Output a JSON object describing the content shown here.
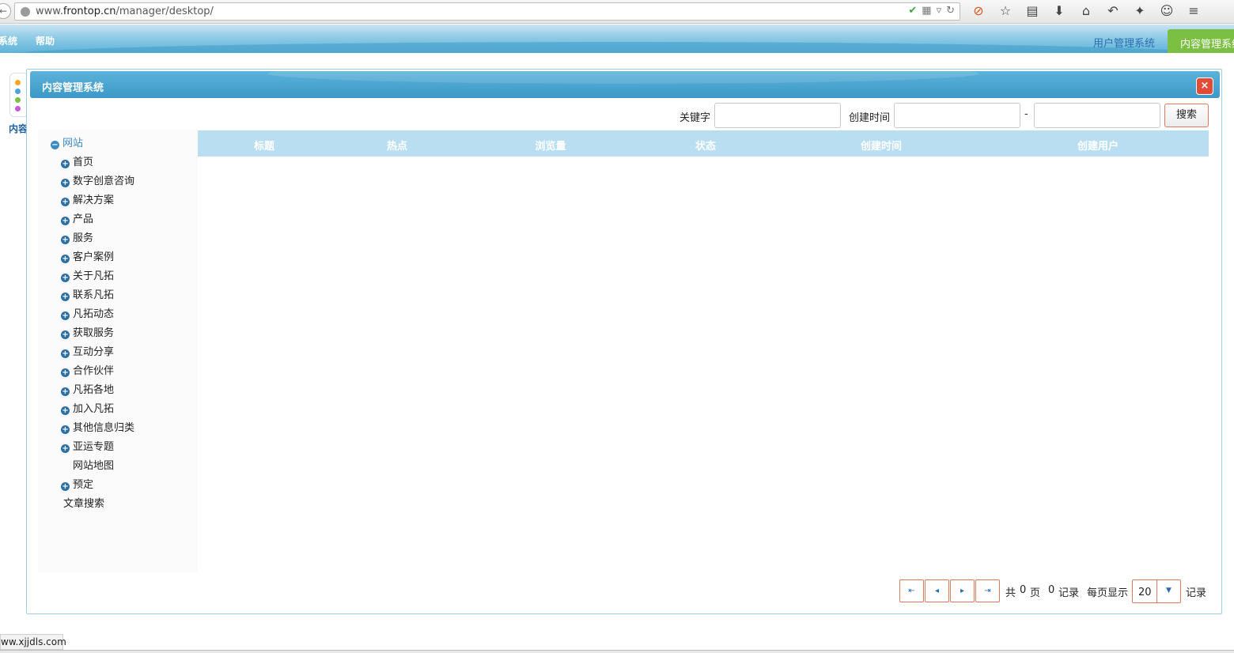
{
  "browser": {
    "url_prefix": "www.",
    "url_domain": "frontop.cn",
    "url_path": "/manager/desktop/"
  },
  "header": {
    "menu": [
      "系统",
      "帮助"
    ],
    "sys_link": "用户管理系统",
    "sys_tab_active": "内容管理系统"
  },
  "desktop": {
    "dock_label": "内容"
  },
  "modal": {
    "title": "内容管理系统"
  },
  "search": {
    "keyword_label": "关键字",
    "keyword_value": "",
    "created_label": "创建时间",
    "date_from": "",
    "date_to": "",
    "separator": "-",
    "button": "搜索"
  },
  "tree": {
    "root": "网站",
    "items": [
      {
        "label": "首页",
        "expandable": true
      },
      {
        "label": "数字创意咨询",
        "expandable": true
      },
      {
        "label": "解决方案",
        "expandable": true
      },
      {
        "label": "产品",
        "expandable": true
      },
      {
        "label": "服务",
        "expandable": true
      },
      {
        "label": "客户案例",
        "expandable": true
      },
      {
        "label": "关于凡拓",
        "expandable": true
      },
      {
        "label": "联系凡拓",
        "expandable": true
      },
      {
        "label": "凡拓动态",
        "expandable": true
      },
      {
        "label": "获取服务",
        "expandable": true
      },
      {
        "label": "互动分享",
        "expandable": true
      },
      {
        "label": "合作伙伴",
        "expandable": true
      },
      {
        "label": "凡拓各地",
        "expandable": true
      },
      {
        "label": "加入凡拓",
        "expandable": true
      },
      {
        "label": "其他信息归类",
        "expandable": true
      },
      {
        "label": "亚运专题",
        "expandable": true
      },
      {
        "label": "网站地图",
        "expandable": false
      },
      {
        "label": "预定",
        "expandable": true
      }
    ],
    "tail": "文章搜索"
  },
  "table": {
    "columns": [
      "标题",
      "热点",
      "浏览量",
      "状态",
      "创建时间",
      "创建用户"
    ],
    "rows": []
  },
  "pager": {
    "total_prefix": "共",
    "total_pages": "0",
    "pages_suffix": "页",
    "records": "0",
    "records_suffix": "记录",
    "per_page_label": "每页显示",
    "page_size": "20",
    "page_size_suffix": "记录"
  },
  "status_bar": {
    "text": "ww.xjjdls.com"
  }
}
